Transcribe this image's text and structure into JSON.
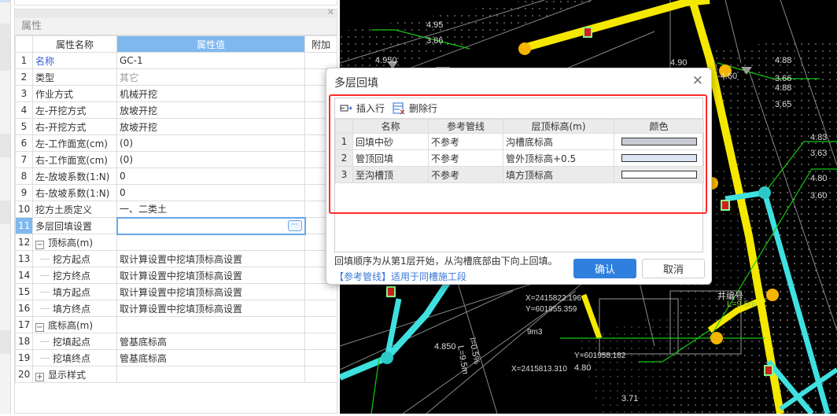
{
  "panel": {
    "title": "属性",
    "columns": [
      "属性名称",
      "属性值",
      "附加"
    ],
    "rows": [
      {
        "n": "1",
        "name": "名称",
        "value": "GC-1"
      },
      {
        "n": "2",
        "name": "类型",
        "value": "其它"
      },
      {
        "n": "3",
        "name": "作业方式",
        "value": "机械开挖"
      },
      {
        "n": "4",
        "name": "左-开挖方式",
        "value": "放坡开挖"
      },
      {
        "n": "5",
        "name": "右-开挖方式",
        "value": "放坡开挖"
      },
      {
        "n": "6",
        "name": "左-工作面宽(cm)",
        "value": "(0)"
      },
      {
        "n": "7",
        "name": "右-工作面宽(cm)",
        "value": "(0)"
      },
      {
        "n": "8",
        "name": "左-放坡系数(1:N)",
        "value": "0"
      },
      {
        "n": "9",
        "name": "右-放坡系数(1:N)",
        "value": "0"
      },
      {
        "n": "10",
        "name": "挖方土质定义",
        "value": "一、二类土"
      },
      {
        "n": "11",
        "name": "多层回填设置",
        "value": "",
        "button": "···"
      },
      {
        "n": "12",
        "name": "顶标高(m)",
        "value": "",
        "toggle": "−"
      },
      {
        "n": "13",
        "name": "挖方起点",
        "value": "取计算设置中挖填顶标高设置"
      },
      {
        "n": "14",
        "name": "挖方终点",
        "value": "取计算设置中挖填顶标高设置"
      },
      {
        "n": "15",
        "name": "填方起点",
        "value": "取计算设置中挖填顶标高设置"
      },
      {
        "n": "16",
        "name": "填方终点",
        "value": "取计算设置中挖填顶标高设置"
      },
      {
        "n": "17",
        "name": "底标高(m)",
        "value": "",
        "toggle": "−"
      },
      {
        "n": "18",
        "name": "挖填起点",
        "value": "管基底标高"
      },
      {
        "n": "19",
        "name": "挖填终点",
        "value": "管基底标高"
      },
      {
        "n": "20",
        "name": "显示样式",
        "value": "",
        "toggle": "+"
      }
    ]
  },
  "dialog": {
    "title": "多层回填",
    "toolbar": {
      "insert": "插入行",
      "delete": "删除行"
    },
    "columns": [
      "名称",
      "参考管线",
      "层顶标高(m)",
      "颜色"
    ],
    "rows": [
      {
        "n": "1",
        "name": "回填中砂",
        "ref": "不参考",
        "top": "沟槽底标高",
        "color": "#c8cad6"
      },
      {
        "n": "2",
        "name": "管顶回填",
        "ref": "不参考",
        "top": "管外顶标高+0.5",
        "color": "#dce4f2"
      },
      {
        "n": "3",
        "name": "至沟槽顶",
        "ref": "不参考",
        "top": "填方顶标高",
        "color": "#ffffff"
      }
    ],
    "note": "回填顺序为从第1层开始，从沟槽底部由下向上回填。",
    "link": "【参考管线】适用于同槽施工段",
    "ok": "确认",
    "cancel": "取消"
  },
  "cad": {
    "labels": [
      "4.95",
      "3.86",
      "4.950",
      "4.90",
      "4.88",
      "3.66",
      "4.88",
      "3.65",
      "4.83",
      "3.63",
      "4.80",
      "3.60",
      "4.850",
      "X=2415822.196",
      "Y=601955.359",
      "9m3",
      "X=2415813.310",
      "Y=601958.182",
      "4.80",
      "3.71",
      "4.80",
      "i=0.5%",
      "L=9.5m",
      "-4.60",
      "井编号",
      "井编号"
    ],
    "colors": {
      "pipe_yellow": "#f5e800",
      "pipe_cyan": "#3fe0e0",
      "leader": "#11c811",
      "node": "#f5b400"
    }
  }
}
